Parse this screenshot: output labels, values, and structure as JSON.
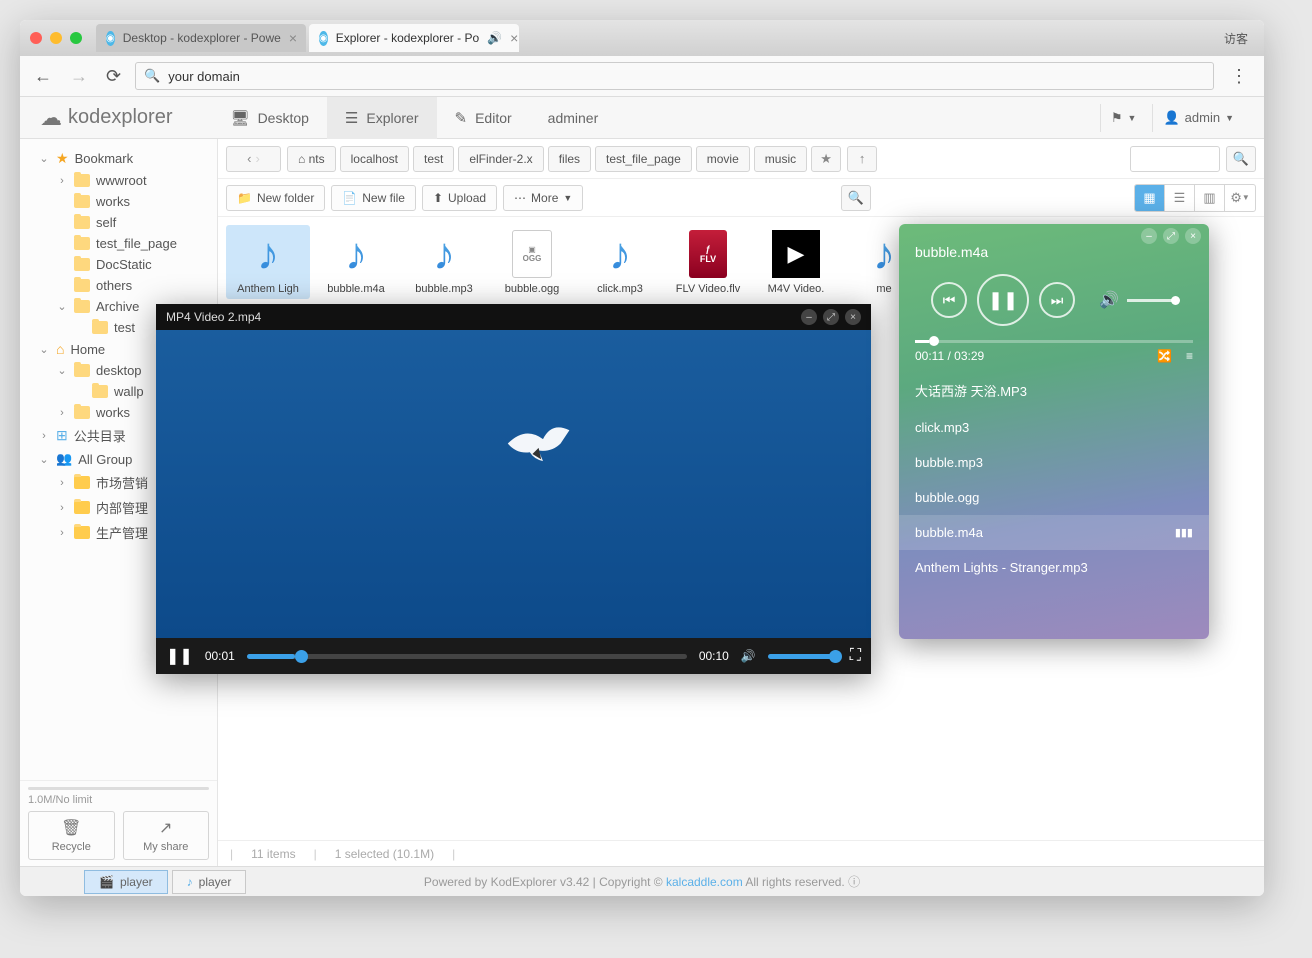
{
  "browser": {
    "guest_label": "访客",
    "tabs": [
      {
        "title": "Desktop - kodexplorer - Powe"
      },
      {
        "title": "Explorer - kodexplorer - Po"
      }
    ],
    "address": "your domain"
  },
  "app": {
    "logo": "kodexplorer",
    "menu": {
      "desktop": "Desktop",
      "explorer": "Explorer",
      "editor": "Editor",
      "adminer": "adminer"
    },
    "user": "admin"
  },
  "sidebar": {
    "bookmark": {
      "label": "Bookmark",
      "items": [
        "wwwroot",
        "works",
        "self",
        "test_file_page",
        "DocStatic",
        "others"
      ],
      "archive": {
        "label": "Archive",
        "items": [
          "test"
        ]
      }
    },
    "home": {
      "label": "Home",
      "desktop": {
        "label": "desktop",
        "items": [
          "wallp"
        ]
      },
      "works": "works"
    },
    "public": "公共目录",
    "group": {
      "label": "All Group",
      "items": [
        "市场营销",
        "内部管理",
        "生产管理"
      ]
    },
    "usage": "1.0M/No limit",
    "recycle": "Recycle",
    "myshare": "My share"
  },
  "pathbar": {
    "crumbs": [
      "nts",
      "localhost",
      "test",
      "elFinder-2.x",
      "files",
      "test_file_page",
      "movie",
      "music"
    ]
  },
  "toolbar": {
    "new_folder": "New folder",
    "new_file": "New file",
    "upload": "Upload",
    "more": "More"
  },
  "files": [
    {
      "name": "Anthem Ligh",
      "type": "audio"
    },
    {
      "name": "bubble.m4a",
      "type": "audio"
    },
    {
      "name": "bubble.mp3",
      "type": "audio"
    },
    {
      "name": "bubble.ogg",
      "type": "ogg"
    },
    {
      "name": "click.mp3",
      "type": "audio"
    },
    {
      "name": "FLV Video.flv",
      "type": "flv"
    },
    {
      "name": "M4V Video.",
      "type": "m4v"
    },
    {
      "name": "me",
      "type": "audio"
    }
  ],
  "status": {
    "items": "11 items",
    "selected": "1 selected (10.1M)"
  },
  "taskbar": {
    "player1": "player",
    "player2": "player"
  },
  "footer": {
    "pre": "Powered by KodExplorer v3.42 | Copyright © ",
    "link": "kalcaddle.com",
    "post": " All rights reserved."
  },
  "video": {
    "title": "MP4 Video 2.mp4",
    "elapsed": "00:01",
    "total": "00:10"
  },
  "audio": {
    "now": "bubble.m4a",
    "time": "00:11 / 03:29",
    "tracks": [
      "大话西游 天浴.MP3",
      "click.mp3",
      "bubble.mp3",
      "bubble.ogg",
      "bubble.m4a",
      "Anthem Lights - Stranger.mp3"
    ],
    "playing_idx": 4
  }
}
